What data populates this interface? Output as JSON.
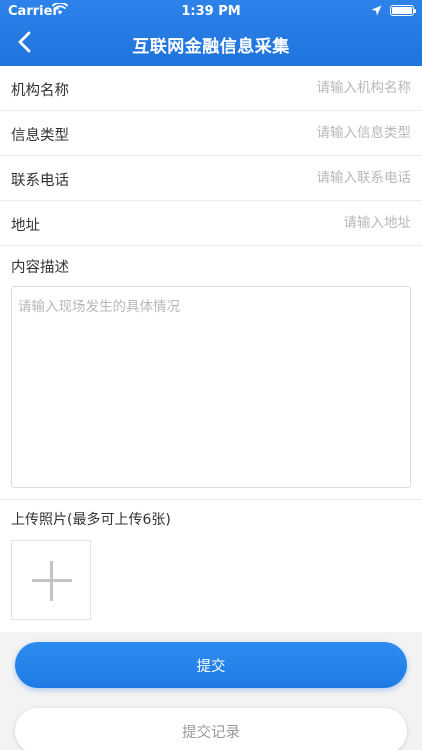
{
  "status_bar": {
    "carrier": "Carrier",
    "time": "1:39 PM",
    "icons": [
      "wifi-icon",
      "location-arrow-icon",
      "battery-icon"
    ]
  },
  "nav": {
    "title": "互联网金融信息采集",
    "back_icon": "chevron-left-icon"
  },
  "form": {
    "fields": [
      {
        "label": "机构名称",
        "placeholder": "请输入机构名称",
        "value": ""
      },
      {
        "label": "信息类型",
        "placeholder": "请输入信息类型",
        "value": ""
      },
      {
        "label": "联系电话",
        "placeholder": "请输入联系电话",
        "value": ""
      },
      {
        "label": "地址",
        "placeholder": "请输入地址",
        "value": ""
      }
    ],
    "description": {
      "label": "内容描述",
      "placeholder": "请输入现场发生的具体情况",
      "value": ""
    },
    "photos": {
      "label": "上传照片(最多可上传6张)",
      "add_icon": "plus-icon"
    }
  },
  "actions": {
    "submit_label": "提交",
    "records_label": "提交记录"
  },
  "colors": {
    "header": "#1f73dc",
    "submit_button": "#2d8cf0",
    "placeholder": "#b8b8b8",
    "bottom_background": "#f3f3f3"
  }
}
